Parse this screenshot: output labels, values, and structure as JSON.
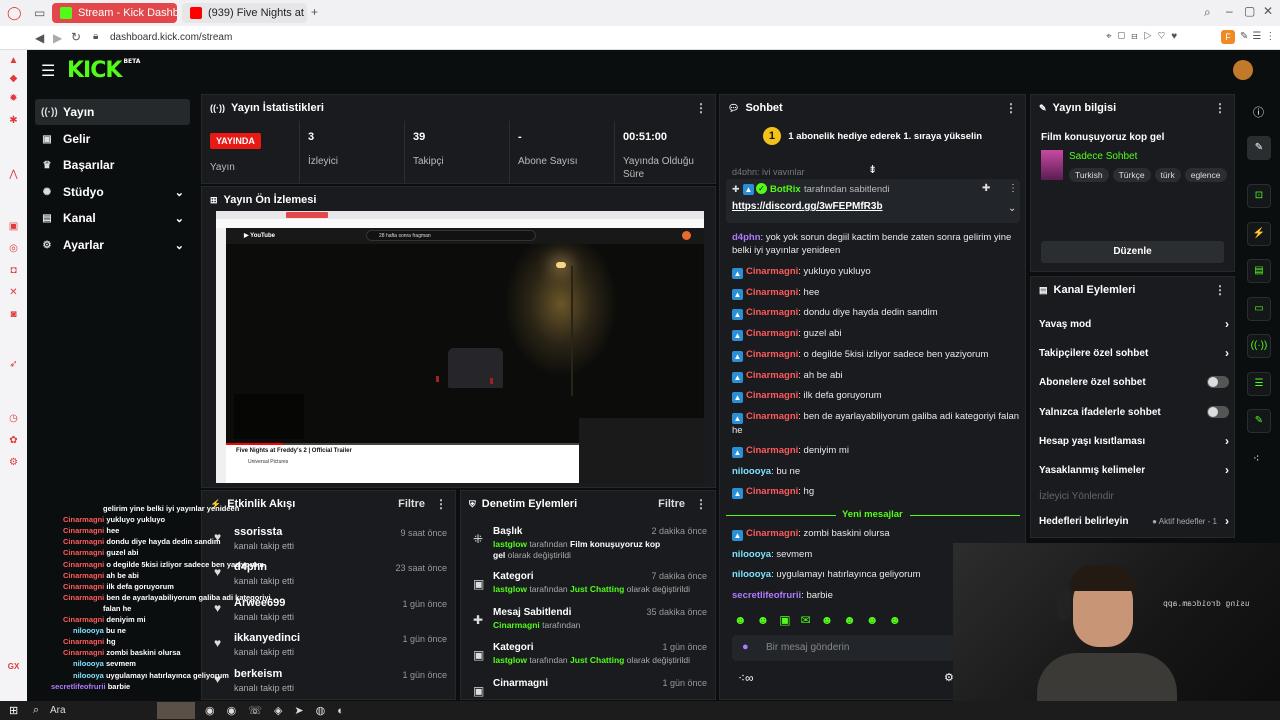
{
  "browser": {
    "tabs": [
      {
        "label": "Stream - Kick Dashboard",
        "active": true
      },
      {
        "label": "(939) Five Nights at Fredd...",
        "active": false
      }
    ],
    "url": "dashboard.kick.com/stream",
    "new_tab": "+",
    "profile_letter": "F"
  },
  "nav": {
    "items": [
      {
        "label": "Yayın",
        "icon": "broadcast-icon",
        "glyph": "((·))"
      },
      {
        "label": "Gelir",
        "icon": "money-icon",
        "glyph": "▣"
      },
      {
        "label": "Başarılar",
        "icon": "trophy-icon",
        "glyph": "♛"
      },
      {
        "label": "Stüdyo",
        "icon": "studio-icon",
        "glyph": "✺"
      },
      {
        "label": "Kanal",
        "icon": "channel-icon",
        "glyph": "▤"
      },
      {
        "label": "Ayarlar",
        "icon": "settings-icon",
        "glyph": "⚙"
      }
    ],
    "chev": "⌄"
  },
  "stats": {
    "title": "Yayın İstatistikleri",
    "live_badge": "YAYINDA",
    "cells": [
      {
        "label": "Yayın"
      },
      {
        "value": "3",
        "label": "İzleyici"
      },
      {
        "value": "39",
        "label": "Takipçi"
      },
      {
        "value": "-",
        "label": "Abone Sayısı"
      },
      {
        "value": "00:51:00",
        "label": "Yayında Olduğu Süre"
      }
    ]
  },
  "preview": {
    "title": "Yayın Ön İzlemesi",
    "yt_title": "Five Nights at Freddy's 2 | Official Trailer",
    "yt_channel": "Universal Pictures",
    "yt_search": "28 hafta sonra fragman"
  },
  "feed": {
    "title": "Etkinlik Akışı",
    "filter": "Filtre",
    "rows": [
      {
        "name": "ssorissta",
        "sub": "kanalı takip etti",
        "time": "9 saat önce"
      },
      {
        "name": "d4phn",
        "sub": "kanalı takip etti",
        "time": "23 saat önce"
      },
      {
        "name": "Arwee699",
        "sub": "kanalı takip etti",
        "time": "1 gün önce"
      },
      {
        "name": "ikkanyedinci",
        "sub": "kanalı takip etti",
        "time": "1 gün önce"
      },
      {
        "name": "berkeism",
        "sub": "kanalı takip etti",
        "time": "1 gün önce"
      }
    ]
  },
  "mod": {
    "title": "Denetim Eylemleri",
    "filter": "Filtre",
    "rows": [
      {
        "name": "Başlık",
        "time": "2 dakika önce",
        "user": "lastglow",
        "mid": " tarafından ",
        "value": "Film konuşuyoruz kop gel",
        "end": " olarak değiştirildi",
        "icon": "title-icon",
        "glyph": "⁜"
      },
      {
        "name": "Kategori",
        "time": "7 dakika önce",
        "user": "lastglow",
        "mid": " tarafından ",
        "value": "Just Chatting",
        "end": " olarak değiştirildi",
        "icon": "category-icon",
        "glyph": "▣"
      },
      {
        "name": "Mesaj Sabitlendi",
        "time": "35 dakika önce",
        "user": "Cinarmagni",
        "mid": " tarafından",
        "value": "",
        "end": "",
        "icon": "pin-icon",
        "glyph": "✚"
      },
      {
        "name": "Kategori",
        "time": "1 gün önce",
        "user": "lastglow",
        "mid": " tarafından ",
        "value": "Just Chatting",
        "end": " olarak değiştirildi",
        "icon": "category-icon",
        "glyph": "▣"
      },
      {
        "name": "Cinarmagni",
        "time": "1 gün önce",
        "user": "",
        "mid": "",
        "value": "",
        "end": "",
        "icon": "user-icon",
        "glyph": "▣"
      }
    ]
  },
  "chat": {
    "title": "Sohbet",
    "gift_banner": "1 abonelik hediye ederek 1. sıraya yükselin",
    "gift_rank": "1",
    "top_partial": "d4phn: iyi yayınlar",
    "pinned": {
      "user": "BotRix",
      "suffix": " tarafından sabitlendi",
      "link": "https://discord.gg/3wFEPMfR3b"
    },
    "messages": [
      {
        "user": "d4phn",
        "text": ": yok yok sorun degiil kactim bende zaten sonra gelirim yine belki iyi yayınlar yenideen",
        "color": "#b07aff",
        "badge": false
      },
      {
        "user": "Cinarmagni",
        "text": ": yukluyo yukluyo",
        "color": "#ff5a5a",
        "badge": true
      },
      {
        "user": "Cinarmagni",
        "text": ": hee",
        "color": "#ff5a5a",
        "badge": true
      },
      {
        "user": "Cinarmagni",
        "text": ": dondu diye hayda dedin sandim",
        "color": "#ff5a5a",
        "badge": true
      },
      {
        "user": "Cinarmagni",
        "text": ": guzel abi",
        "color": "#ff5a5a",
        "badge": true
      },
      {
        "user": "Cinarmagni",
        "text": ": o degilde 5kisi izliyor sadece ben yaziyorum",
        "color": "#ff5a5a",
        "badge": true
      },
      {
        "user": "Cinarmagni",
        "text": ": ah be abi",
        "color": "#ff5a5a",
        "badge": true
      },
      {
        "user": "Cinarmagni",
        "text": ": ilk defa goruyorum",
        "color": "#ff5a5a",
        "badge": true
      },
      {
        "user": "Cinarmagni",
        "text": ": ben de ayarlayabiliyorum galiba adi kategoriyi falan he",
        "color": "#ff5a5a",
        "badge": true
      },
      {
        "user": "Cinarmagni",
        "text": ": deniyim mi",
        "color": "#ff5a5a",
        "badge": true
      },
      {
        "user": "niloooya",
        "text": ": bu ne",
        "color": "#7ee2ff",
        "badge": false
      },
      {
        "user": "Cinarmagni",
        "text": ": hg",
        "color": "#ff5a5a",
        "badge": true
      }
    ],
    "new_messages": "Yeni mesajlar",
    "new": [
      {
        "user": "Cinarmagni",
        "text": ": zombi baskini olursa",
        "color": "#ff5a5a",
        "badge": true
      },
      {
        "user": "niloooya",
        "text": ": sevmem",
        "color": "#7ee2ff",
        "badge": false
      },
      {
        "user": "niloooya",
        "text": ": uygulamayı hatırlayınca geliyorum",
        "color": "#7ee2ff",
        "badge": false
      },
      {
        "user": "secretlifeofrurii",
        "text": ": barbie",
        "color": "#b07aff",
        "badge": false
      }
    ],
    "placeholder": "Bir mesaj gönderin"
  },
  "info": {
    "title": "Yayın bilgisi",
    "stream_title": "Film konuşuyoruz kop gel",
    "category": "Sadece Sohbet",
    "tags": [
      "Turkish",
      "Türkçe",
      "türk",
      "eglence"
    ],
    "edit": "Düzenle"
  },
  "actions": {
    "title": "Kanal Eylemleri",
    "rows": [
      {
        "label": "Yavaş mod",
        "kind": "chev"
      },
      {
        "label": "Takipçilere özel sohbet",
        "kind": "chev"
      },
      {
        "label": "Abonelere özel sohbet",
        "kind": "toggle"
      },
      {
        "label": "Yalnızca ifadelerle sohbet",
        "kind": "toggle"
      },
      {
        "label": "Hesap yaşı kısıtlaması",
        "kind": "chev"
      },
      {
        "label": "Yasaklanmış kelimeler",
        "kind": "chev"
      }
    ],
    "disabled": "İzleyici Yönlendir",
    "goals": "Hedefleri belirleyin",
    "goals_status": "● Aktif hedefler - 1"
  },
  "overlay": {
    "webcam_text": "using droidcam.app",
    "lines": [
      {
        "user": "",
        "text": "gelirim yine belki iyi yayınlar yenideen"
      },
      {
        "user": "Cinarmagni",
        "text": "yukluyo yukluyo"
      },
      {
        "user": "Cinarmagni",
        "text": "hee"
      },
      {
        "user": "Cinarmagni",
        "text": "dondu diye hayda dedin sandim"
      },
      {
        "user": "Cinarmagni",
        "text": "guzel abi"
      },
      {
        "user": "Cinarmagni",
        "text": "o degilde 5kisi izliyor sadece ben yaziyorum"
      },
      {
        "user": "Cinarmagni",
        "text": "ah be abi"
      },
      {
        "user": "Cinarmagni",
        "text": "ilk defa goruyorum"
      },
      {
        "user": "Cinarmagni",
        "text": "ben de ayarlayabiliyorum galiba adi kategoriyi"
      },
      {
        "user": "",
        "text": "falan he"
      },
      {
        "user": "Cinarmagni",
        "text": "deniyim mi"
      },
      {
        "user": "niloooya",
        "text": "bu ne"
      },
      {
        "user": "Cinarmagni",
        "text": "hg"
      },
      {
        "user": "Cinarmagni",
        "text": "zombi baskini olursa"
      },
      {
        "user": "niloooya",
        "text": "sevmem"
      },
      {
        "user": "niloooya",
        "text": "uygulamayı hatırlayınca geliyorum"
      },
      {
        "user": "secretlifeofrurii",
        "text": "barbie"
      }
    ]
  },
  "taskbar": {
    "search": "Ara"
  },
  "colors": {
    "kick_green": "#53fc18",
    "live_red": "#e91916",
    "panel": "#191b1f",
    "bg": "#0b0e0f"
  }
}
